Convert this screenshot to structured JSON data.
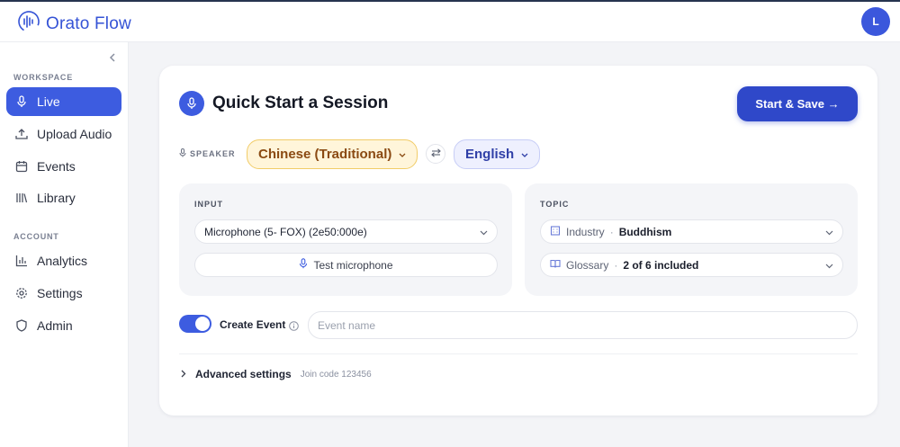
{
  "app": {
    "name": "Orato Flow",
    "user_initial": "L"
  },
  "sidebar": {
    "workspace_label": "WORKSPACE",
    "account_label": "ACCOUNT",
    "workspace_items": [
      {
        "label": "Live",
        "icon": "microphone-icon",
        "active": true
      },
      {
        "label": "Upload Audio",
        "icon": "upload-icon"
      },
      {
        "label": "Events",
        "icon": "calendar-icon"
      },
      {
        "label": "Library",
        "icon": "library-icon"
      }
    ],
    "account_items": [
      {
        "label": "Analytics",
        "icon": "analytics-icon"
      },
      {
        "label": "Settings",
        "icon": "gear-icon"
      },
      {
        "label": "Admin",
        "icon": "shield-icon"
      }
    ]
  },
  "session": {
    "title": "Quick Start a Session",
    "start_button": "Start & Save →",
    "speaker_label": "SPEAKER",
    "source_language": "Chinese (Traditional)",
    "target_language": "English",
    "input": {
      "title": "INPUT",
      "device": "Microphone (5- FOX) (2e50:000e)",
      "test_button": "Test microphone"
    },
    "topic": {
      "title": "TOPIC",
      "industry_label": "Industry",
      "industry_value": "Buddhism",
      "glossary_label": "Glossary",
      "glossary_value": "2 of 6 included"
    },
    "create_event_label": "Create Event",
    "create_event_on": true,
    "event_name_placeholder": "Event name",
    "advanced_label": "Advanced settings",
    "join_code": "Join code 123456"
  },
  "colors": {
    "accent": "#3d5ce0",
    "source_bg": "#fff5da",
    "target_bg": "#eef0fe"
  }
}
